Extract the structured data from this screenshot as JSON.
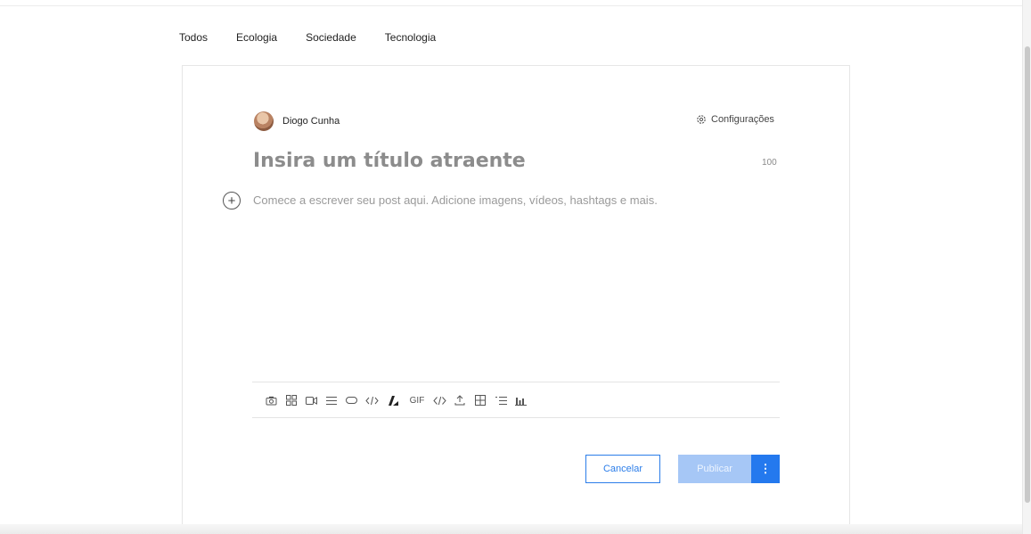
{
  "categories": [
    "Todos",
    "Ecologia",
    "Sociedade",
    "Tecnologia"
  ],
  "author": {
    "name": "Diogo Cunha"
  },
  "settings": {
    "label": "Configurações",
    "icon": "gear-icon"
  },
  "editor": {
    "title_placeholder": "Insira um título atraente",
    "title_char_limit": "100",
    "body_placeholder": "Comece a escrever seu post aqui. Adicione imagens, vídeos, hashtags e mais.",
    "add_icon": "plus-circle-icon"
  },
  "toolbar": {
    "gif_label": "GIF",
    "items": [
      "camera-icon",
      "gallery-icon",
      "video-icon",
      "divider-icon",
      "button-icon",
      "code-icon",
      "ai-writer-icon",
      "gif-icon",
      "embed-icon",
      "upload-icon",
      "table-icon",
      "list-icon",
      "chart-icon"
    ]
  },
  "actions": {
    "cancel_label": "Cancelar",
    "publish_label": "Publicar",
    "more_glyph": "⋮"
  },
  "colors": {
    "accent": "#2479ee",
    "publish_disabled": "#a6c7f6",
    "placeholder": "#9a9a9a"
  }
}
